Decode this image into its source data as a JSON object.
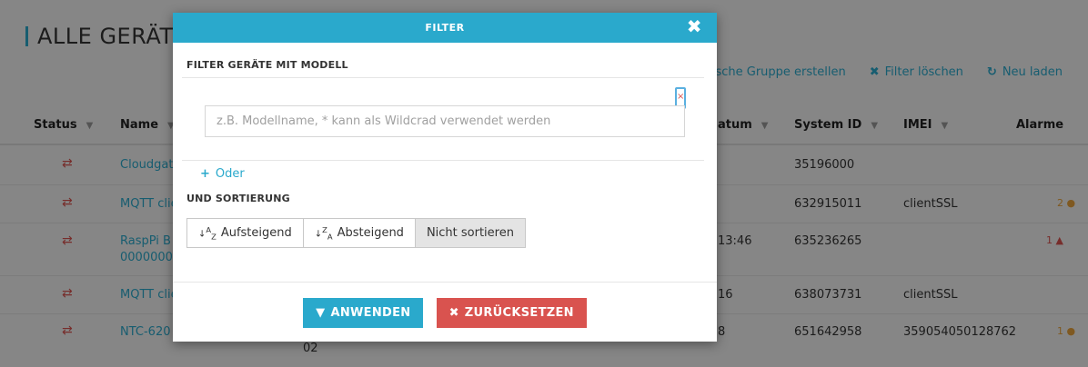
{
  "page": {
    "title": "ALLE GERÄTE",
    "toolbar": [
      {
        "icon": "",
        "label": "ische Gruppe erstellen"
      },
      {
        "icon": "✖",
        "label": "Filter löschen"
      },
      {
        "icon": "↻",
        "label": "Neu laden"
      }
    ]
  },
  "table": {
    "columns": [
      "Status",
      "Name",
      "atum",
      "System ID",
      "IMEI",
      "Alarme"
    ],
    "rows": [
      {
        "status": "⇄",
        "name": "Cloudgate",
        "date": "",
        "system_id": "35196000",
        "imei": "",
        "alarm": ""
      },
      {
        "status": "⇄",
        "name": "MQTT clie",
        "date": "",
        "system_id": "632915011",
        "imei": "clientSSL",
        "alarm": "2 ●"
      },
      {
        "status": "⇄",
        "name": "RaspPi B",
        "name2": "00000000",
        "date": "13:46",
        "system_id": "635236265",
        "imei": "",
        "alarm": "1 ▲"
      },
      {
        "status": "⇄",
        "name": "MQTT clie",
        "date": "16",
        "system_id": "638073731",
        "imei": "clientSSL",
        "alarm": ""
      },
      {
        "status": "⇄",
        "name": "NTC-620",
        "date": "8",
        "extra": "02",
        "system_id": "651642958",
        "imei": "359054050128762",
        "alarm": "1 ●"
      }
    ]
  },
  "modal": {
    "title": "FILTER",
    "close_icon": "✖",
    "section_model": "FILTER GERÄTE MIT MODELL",
    "input_placeholder": "z.B. Modellname, * kann als Wildcrad verwendet werden",
    "input_value": "",
    "clear_icon": "×",
    "or_label": "Oder",
    "section_sort": "UND SORTIERUNG",
    "sort": {
      "ascending": "Aufsteigend",
      "descending": "Absteigend",
      "none": "Nicht sortieren",
      "selected": "none"
    },
    "apply_label": "ANWENDEN",
    "reset_label": "ZURÜCKSETZEN"
  },
  "colors": {
    "accent": "#2aa9cc",
    "danger": "#d9534f",
    "warning": "#e8a23c"
  }
}
